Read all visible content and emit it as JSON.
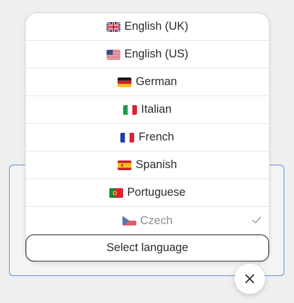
{
  "languages": [
    {
      "label": "English (UK)",
      "flag": "uk-flag-icon"
    },
    {
      "label": "English (US)",
      "flag": "us-flag-icon"
    },
    {
      "label": "German",
      "flag": "germany-flag-icon"
    },
    {
      "label": "Italian",
      "flag": "italy-flag-icon"
    },
    {
      "label": "French",
      "flag": "france-flag-icon"
    },
    {
      "label": "Spanish",
      "flag": "spain-flag-icon"
    },
    {
      "label": "Portuguese",
      "flag": "portugal-flag-icon"
    },
    {
      "label": "Czech",
      "flag": "czech-flag-icon",
      "selected": true
    }
  ],
  "select_button": {
    "label": "Select language"
  },
  "close_button": {
    "icon": "close-icon"
  },
  "colors": {
    "accent_border": "#5b8fd6",
    "selected_text": "#8f8f8f",
    "check": "#9a9a9a"
  }
}
